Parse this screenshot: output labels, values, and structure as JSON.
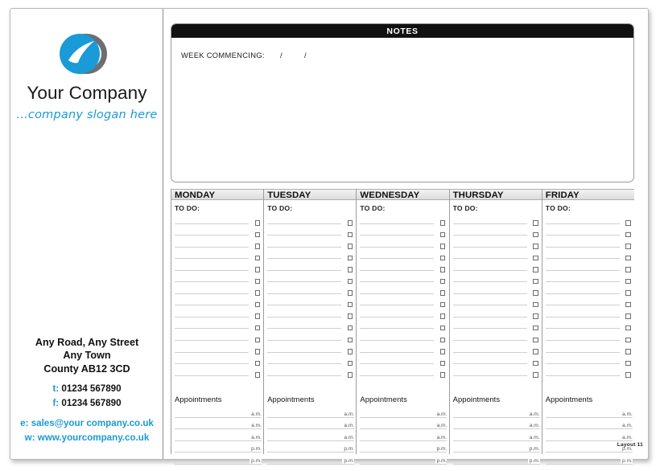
{
  "brand": {
    "company_name": "Your Company",
    "slogan": "...company slogan here",
    "logo_icon": "circular-swoosh-logo",
    "accent_color": "#1a9ad6",
    "dark_color": "#6d6e71"
  },
  "address": {
    "line1": "Any Road, Any Street",
    "line2": "Any Town",
    "line3": "County AB12 3CD",
    "tel_label": "t:",
    "tel_value": "01234 567890",
    "fax_label": "f:",
    "fax_value": "01234 567890",
    "email_label": "e:",
    "email_value": "sales@your company.co.uk",
    "web_label": "w:",
    "web_value": "www.yourcompany.co.uk"
  },
  "notes": {
    "header": "NOTES",
    "week_commencing_label": "WEEK COMMENCING:",
    "slash": "/"
  },
  "planner": {
    "todo_label": "TO DO:",
    "appointments_label": "Appointments",
    "am_label": "a.m.",
    "pm_label": "p.m.",
    "todo_rows": 14,
    "appointment_rows": 5,
    "appointment_meridiems": [
      "a.m.",
      "a.m.",
      "a.m.",
      "p.m.",
      "p.m."
    ],
    "days": [
      {
        "name": "MONDAY"
      },
      {
        "name": "TUESDAY"
      },
      {
        "name": "WEDNESDAY"
      },
      {
        "name": "THURSDAY"
      },
      {
        "name": "FRIDAY"
      }
    ]
  },
  "footer": {
    "layout_tag": "Layout 11"
  }
}
